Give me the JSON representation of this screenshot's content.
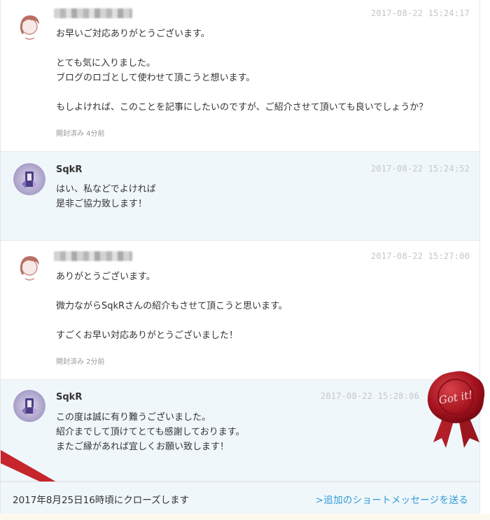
{
  "messages": [
    {
      "sender": "",
      "timestamp": "2017-08-22 15:24:17",
      "lines": [
        "お早いご対応ありがとうございます。",
        "",
        "とても気に入りました。",
        "ブログのロゴとして使わせて頂こうと想います。",
        "",
        "もしよければ、このことを記事にしたいのですが、ご紹介させて頂いても良いでしょうか？"
      ],
      "read_status": "開封済み 4分前"
    },
    {
      "sender": "SqkR",
      "timestamp": "2017-08-22 15:24:52",
      "lines": [
        "はい、私などでよければ",
        "是非ご協力致します！"
      ]
    },
    {
      "sender": "",
      "timestamp": "2017-08-22 15:27:00",
      "lines": [
        "ありがとうございます。",
        "",
        "微力ながらSqkRさんの紹介もさせて頂こうと思います。",
        "",
        "すごくお早い対応ありがとうございました！"
      ],
      "read_status": "開封済み 2分前"
    },
    {
      "sender": "SqkR",
      "timestamp": "2017-08-22 15:28:06",
      "lines": [
        "この度は誠に有り難うございました。",
        "紹介までして頂けてとても感謝しております。",
        "またご縁があれば宜しくお願い致します！"
      ]
    }
  ],
  "footer": {
    "close_notice": "2017年8月25日16時頃にクローズします",
    "send_link": ">追加のショートメッセージを送る"
  },
  "seal": {
    "text": "Got it!"
  },
  "colors": {
    "seller_bg": "#f0f7fb",
    "link": "#2e9bd6",
    "seal_red": "#b3202a",
    "timestamp": "#c2c6ca"
  },
  "icons": [
    "buyer-avatar",
    "seller-avatar",
    "got-it-seal",
    "corner-ribbon"
  ]
}
